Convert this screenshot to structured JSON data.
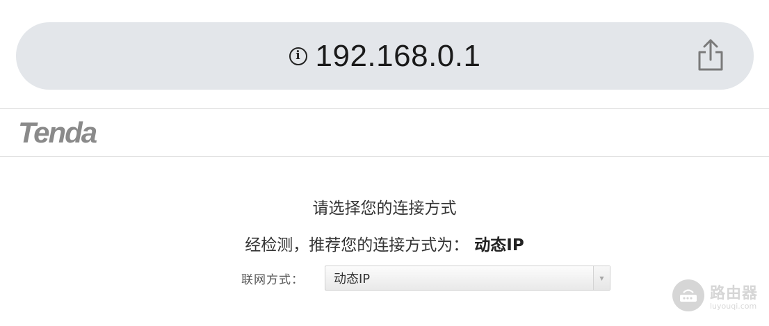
{
  "browser": {
    "url": "192.168.0.1",
    "info_icon": "info-icon",
    "share_icon": "share-icon"
  },
  "header": {
    "logo_text": "Tenda"
  },
  "main": {
    "title": "请选择您的连接方式",
    "recommend_prefix": "经检测，推荐您的连接方式为：",
    "recommend_value": "动态IP",
    "connection_label": "联网方式：",
    "connection_selected": "动态IP"
  },
  "watermark": {
    "main": "路由器",
    "sub": "luyouqi.com"
  },
  "colors": {
    "urlbar_bg": "#e3e6ea",
    "logo": "#8a8a8a",
    "text": "#333333"
  }
}
